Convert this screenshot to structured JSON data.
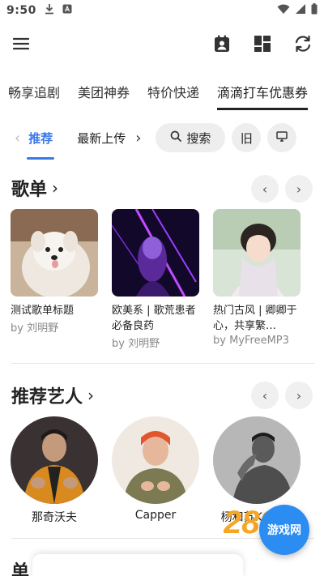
{
  "status_bar": {
    "time": "9:50"
  },
  "top_tabs": [
    "畅享追剧",
    "美团神券",
    "特价快递",
    "滴滴打车优惠券"
  ],
  "sub_nav": {
    "tabs": [
      "推荐",
      "最新上传"
    ],
    "search_label": "搜索",
    "old_label": "旧"
  },
  "playlists": {
    "title": "歌单",
    "items": [
      {
        "title": "测试歌单标题",
        "by": "by 刘明野"
      },
      {
        "title": "欧美系 | 歌荒患者必备良药",
        "by": "by 刘明野"
      },
      {
        "title": "热门古风 | 卿卿于心，共享繁…",
        "by": "by MyFreeMP3"
      }
    ]
  },
  "artists": {
    "title": "推荐艺人",
    "items": [
      {
        "name": "那奇沃夫"
      },
      {
        "name": "Capper"
      },
      {
        "name": "杨和苏KeyNG"
      }
    ]
  },
  "next_section_title": "单",
  "watermark": {
    "number": "289",
    "site": "游戏网"
  },
  "colors": {
    "accent": "#3a78e8",
    "fab": "#2b8cf2",
    "watermark_orange": "#f5a623"
  },
  "icons": {
    "menu": "menu-icon",
    "calendar": "calendar-user-icon",
    "dashboard": "dashboard-icon",
    "sync": "sync-icon",
    "search": "search-icon",
    "monitor": "monitor-icon"
  }
}
